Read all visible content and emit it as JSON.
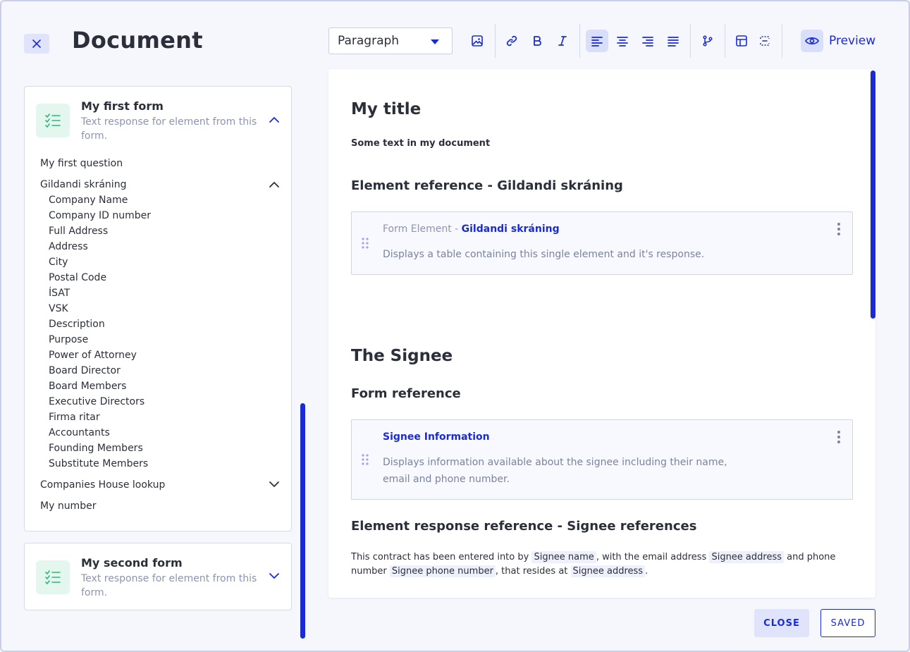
{
  "header": {
    "title": "Document",
    "block_select": "Paragraph",
    "preview_label": "Preview"
  },
  "forms": [
    {
      "title": "My first form",
      "description": "Text response for element from this form.",
      "questions": [
        {
          "label": "My first question"
        },
        {
          "label": "Gildandi skráning",
          "children": [
            "Company Name",
            "Company ID number",
            "Full Address",
            "Address",
            "City",
            "Postal Code",
            "ÍSAT",
            "VSK",
            "Description",
            "Purpose",
            "Power of Attorney",
            "Board Director",
            "Board Members",
            "Executive Directors",
            "Firma ritar",
            "Accountants",
            "Founding Members",
            "Substitute Members"
          ]
        },
        {
          "label": "Companies House lookup"
        },
        {
          "label": "My number"
        }
      ]
    },
    {
      "title": "My second form",
      "description": "Text response for element from this form."
    }
  ],
  "editor": {
    "title": "My title",
    "intro": "Some text in my document",
    "section1_heading": "Element reference - Gildandi skráning",
    "ref1": {
      "prefix": "Form Element - ",
      "link": "Gildandi skráning",
      "desc": "Displays a table containing this single element and it's response."
    },
    "section2_title": "The Signee",
    "section2_heading": "Form reference",
    "ref2": {
      "link": "Signee Information",
      "desc_line1": "Displays information available about the signee including their name,",
      "desc_line2": "email and phone number."
    },
    "section3_heading": "Element response reference - Signee references",
    "para": {
      "t1": "This contract has been entered into by ",
      "c1": "Signee name",
      "t2": ", with the email address ",
      "c2": "Signee address",
      "t3": " and phone number ",
      "c3": "Signee phone number",
      "t4": ", that resides at ",
      "c4": "Signee address",
      "t5": "."
    }
  },
  "footer": {
    "close_label": "CLOSE",
    "saved_label": "SAVED"
  },
  "colors": {
    "accent": "#1a2bd6",
    "accent_soft": "#dfe4fb",
    "form_icon_bg": "#e3f7ef",
    "form_icon_fg": "#2fb87a"
  }
}
